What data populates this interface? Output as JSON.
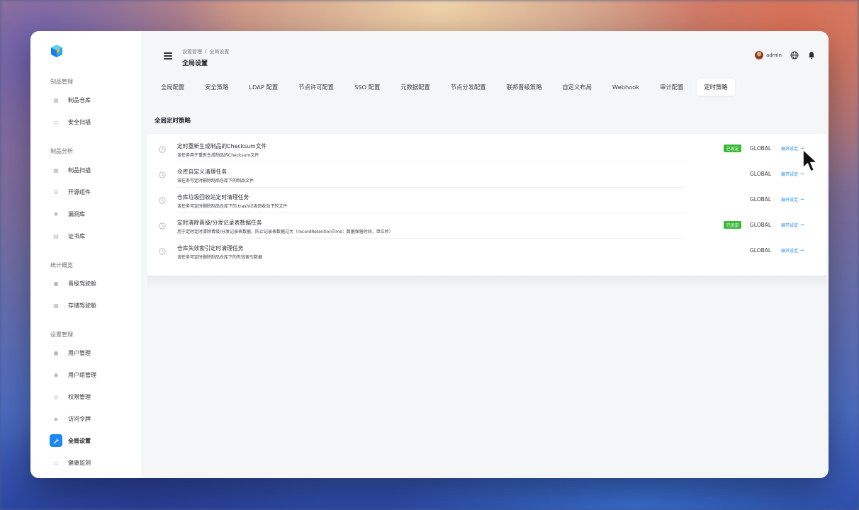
{
  "sidebar": {
    "groups": [
      {
        "title": "制品管理",
        "items": [
          {
            "label": "制品仓库",
            "icon": "box-icon"
          },
          {
            "label": "安全扫描",
            "icon": "scan-icon"
          }
        ]
      },
      {
        "title": "制品分析",
        "items": [
          {
            "label": "制品扫描",
            "icon": "grid-icon"
          },
          {
            "label": "开源组件",
            "icon": "list-icon"
          },
          {
            "label": "漏洞库",
            "icon": "bug-icon"
          },
          {
            "label": "证书库",
            "icon": "document-icon"
          }
        ]
      },
      {
        "title": "统计概览",
        "items": [
          {
            "label": "晋级驾驶舱",
            "icon": "user-icon"
          },
          {
            "label": "存储驾驶舱",
            "icon": "grid-icon"
          }
        ]
      },
      {
        "title": "设置管理",
        "items": [
          {
            "label": "用户管理",
            "icon": "users-icon"
          },
          {
            "label": "用户组管理",
            "icon": "user-group-icon"
          },
          {
            "label": "权限管理",
            "icon": "shield-icon"
          },
          {
            "label": "访问令牌",
            "icon": "lock-icon"
          },
          {
            "label": "全局设置",
            "icon": "wrench-icon",
            "active": true
          },
          {
            "label": "健康监测",
            "icon": "monitor-icon"
          }
        ]
      }
    ]
  },
  "header": {
    "breadcrumb": [
      "设置管理",
      "/",
      "全局设置"
    ],
    "title": "全局设置",
    "user": "admin"
  },
  "tabs": [
    {
      "label": "全局配置"
    },
    {
      "label": "安全策略"
    },
    {
      "label": "LDAP 配置"
    },
    {
      "label": "节点许可配置"
    },
    {
      "label": "SSO 配置"
    },
    {
      "label": "元数据配置"
    },
    {
      "label": "节点分发配置"
    },
    {
      "label": "联邦晋级策略"
    },
    {
      "label": "自定义布局"
    },
    {
      "label": "Webhook"
    },
    {
      "label": "审计配置"
    },
    {
      "label": "定时策略",
      "active": true
    }
  ],
  "section": {
    "title": "全局定时策略",
    "rows": [
      {
        "name": "定时重新生成制品的Checksum文件",
        "desc": "该任务用于重新生成制品的Checksum文件",
        "badge": "已设定",
        "scope": "GLOBAL",
        "link": "展开设定"
      },
      {
        "name": "仓库自定义清理任务",
        "desc": "该任务可定时删除制品仓库下的制品文件",
        "badge": "",
        "scope": "GLOBAL",
        "link": "展开设定"
      },
      {
        "name": "仓库垃圾回收站定时清理任务",
        "desc": "该任务可定时删除制品仓库下的.trash垃圾回收站下的文件",
        "badge": "",
        "scope": "GLOBAL",
        "link": "展开设定"
      },
      {
        "name": "定时清除晋级/分发记录表数据任务",
        "desc": "用于定时定时清除晋级/分发记录表数据，防止记录表数据过大（recordRetentionTime：数据保留时间，单位秒）",
        "badge": "已设定",
        "scope": "GLOBAL",
        "link": "展开设定"
      },
      {
        "name": "仓库失效索引定时清理任务",
        "desc": "该任务可定时删除制品仓库下的失效索引数据",
        "badge": "",
        "scope": "GLOBAL",
        "link": "展开设定"
      }
    ]
  },
  "colors": {
    "accent": "#1e88f0",
    "badge": "#3dba3a"
  }
}
